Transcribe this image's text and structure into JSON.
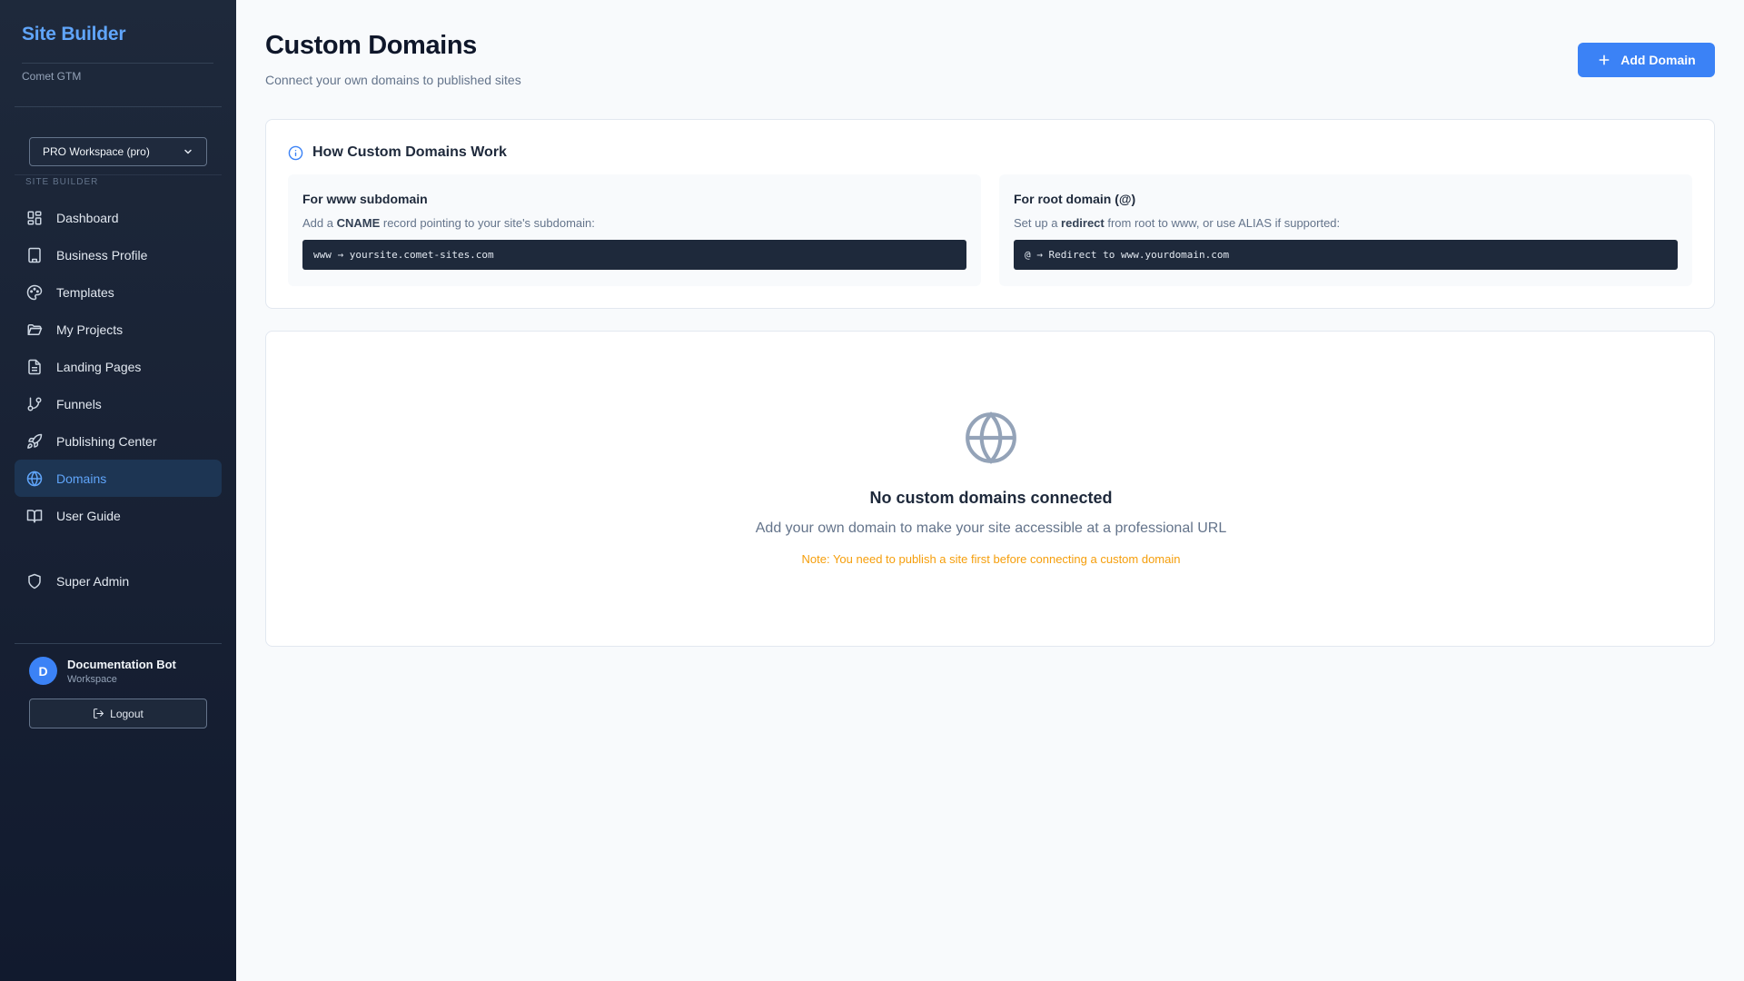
{
  "sidebar": {
    "brand": "Site Builder",
    "org": "Comet GTM",
    "workspace_select": "PRO Workspace (pro)",
    "section_label": "SITE BUILDER",
    "items": [
      {
        "label": "Dashboard",
        "icon": "dashboard-icon"
      },
      {
        "label": "Business Profile",
        "icon": "building-icon"
      },
      {
        "label": "Templates",
        "icon": "palette-icon"
      },
      {
        "label": "My Projects",
        "icon": "folder-icon"
      },
      {
        "label": "Landing Pages",
        "icon": "file-icon"
      },
      {
        "label": "Funnels",
        "icon": "git-branch-icon"
      },
      {
        "label": "Publishing Center",
        "icon": "rocket-icon"
      },
      {
        "label": "Domains",
        "icon": "globe-icon",
        "active": true
      },
      {
        "label": "User Guide",
        "icon": "book-icon"
      }
    ],
    "super_admin": "Super Admin",
    "user": {
      "initial": "D",
      "name": "Documentation Bot",
      "role": "Workspace"
    },
    "logout": "Logout"
  },
  "header": {
    "title": "Custom Domains",
    "subtitle": "Connect your own domains to published sites",
    "add_button": "Add Domain"
  },
  "info": {
    "title": "How Custom Domains Work",
    "www": {
      "title": "For www subdomain",
      "desc_prefix": "Add a ",
      "desc_bold": "CNAME",
      "desc_suffix": " record pointing to your site's subdomain:",
      "code": "www → yoursite.comet-sites.com"
    },
    "root": {
      "title": "For root domain (@)",
      "desc_prefix": "Set up a ",
      "desc_bold": "redirect",
      "desc_suffix": " from root to www, or use ALIAS if supported:",
      "code": "@ → Redirect to www.yourdomain.com"
    }
  },
  "empty": {
    "title": "No custom domains connected",
    "subtitle": "Add your own domain to make your site accessible at a professional URL",
    "note": "Note: You need to publish a site first before connecting a custom domain"
  },
  "colors": {
    "accent": "#3b82f6",
    "sidebar_bg": "#1e293b",
    "warning": "#f59e0b"
  }
}
